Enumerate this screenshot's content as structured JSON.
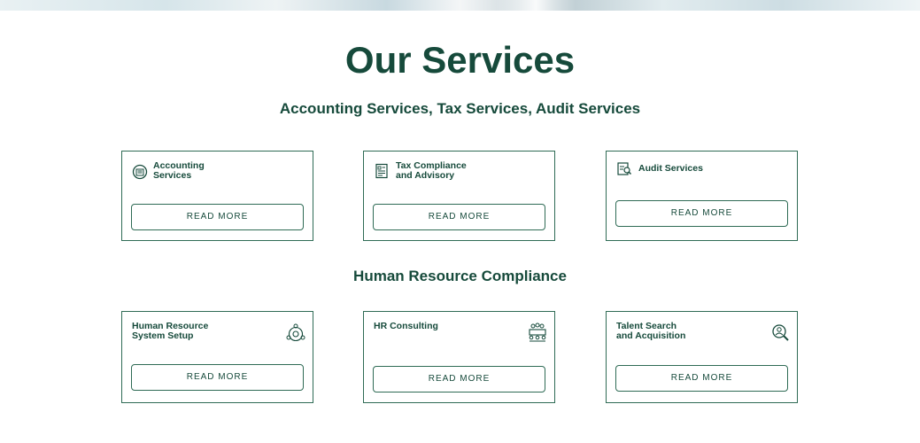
{
  "page": {
    "title": "Our Services",
    "subtitle_1": "Accounting Services, Tax Services, Audit Services",
    "subtitle_2": "Human Resource Compliance"
  },
  "cards_row1": [
    {
      "title_l1": "Accounting",
      "title_l2": "Services",
      "icon": "accounting-icon",
      "button": "READ MORE"
    },
    {
      "title_l1": "Tax Compliance",
      "title_l2": "and Advisory",
      "icon": "tax-document-icon",
      "button": "READ MORE"
    },
    {
      "title_l1": "Audit Services",
      "title_l2": "",
      "icon": "audit-magnifier-icon",
      "button": "READ MORE"
    }
  ],
  "cards_row2": [
    {
      "title_l1": "Human Resource",
      "title_l2": "System Setup",
      "icon": "hr-system-gear-icon",
      "button": "READ MORE"
    },
    {
      "title_l1": "HR Consulting",
      "title_l2": "",
      "icon": "consulting-meeting-icon",
      "button": "READ MORE"
    },
    {
      "title_l1": "Talent Search",
      "title_l2": "and Acquisition",
      "icon": "talent-search-icon",
      "button": "READ MORE"
    }
  ],
  "colors": {
    "primary": "#164a3b",
    "border": "#2f6b55"
  }
}
